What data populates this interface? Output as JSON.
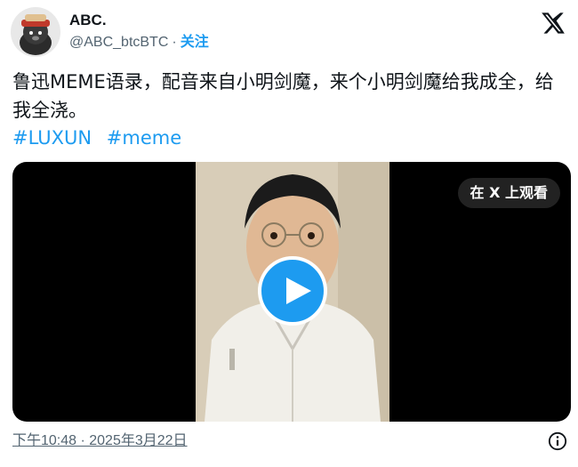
{
  "author": {
    "display_name": "ABC.",
    "handle": "@ABC_btcBTC",
    "separator": "·",
    "follow_label": "关注"
  },
  "tweet": {
    "text": "鲁迅MEME语录，配音来自小明剑魔，来个小明剑魔给我成全，给我全浇。",
    "hashtags": [
      "#LUXUN",
      "#meme"
    ]
  },
  "media": {
    "watch_label": "在 X 上观看"
  },
  "footer": {
    "timestamp": "下午10:48 · 2025年3月22日"
  },
  "colors": {
    "accent": "#1d9bf0",
    "muted": "#536471",
    "text": "#0f1419"
  },
  "icons": {
    "logo": "x-logo-icon",
    "play": "play-icon",
    "info": "info-icon"
  }
}
